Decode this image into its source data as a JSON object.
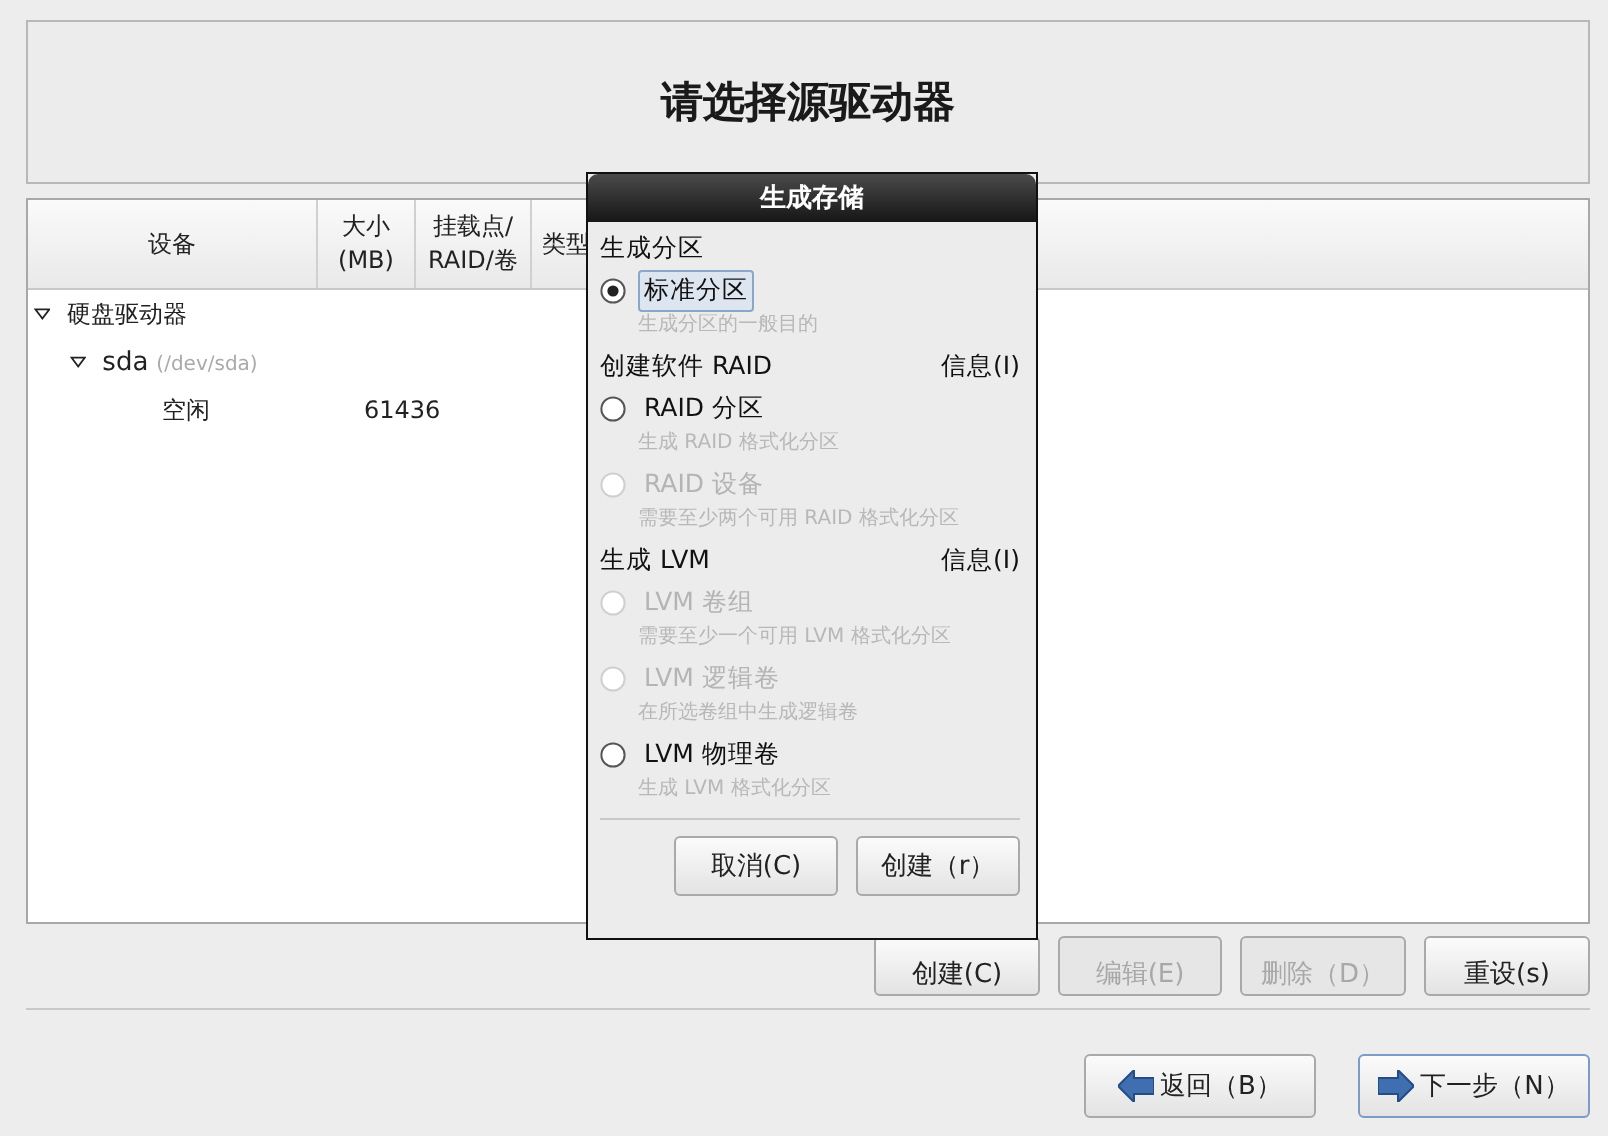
{
  "header": {
    "title": "请选择源驱动器"
  },
  "table": {
    "columns": [
      "设备",
      "大小\n(MB)",
      "挂载点/\nRAID/卷",
      "类型"
    ],
    "rows": [
      {
        "device": "硬盘驱动器",
        "expanded": true,
        "children": [
          {
            "device": "sda",
            "path": "(/dev/sda)",
            "expanded": true,
            "children": [
              {
                "device": "空闲",
                "size": "61436"
              }
            ]
          }
        ]
      }
    ]
  },
  "actions": [
    {
      "label": "创建(C)",
      "disabled": false
    },
    {
      "label": "编辑(E)",
      "disabled": true
    },
    {
      "label": "删除（D）",
      "disabled": true
    },
    {
      "label": "重设(s)",
      "disabled": false
    }
  ],
  "nav": [
    {
      "label": "返回（B）",
      "kind": "back",
      "focused": false
    },
    {
      "label": "下一步（N）",
      "kind": "next",
      "focused": true
    }
  ],
  "dialog": {
    "title": "生成存储",
    "sections": [
      {
        "heading": "生成分区",
        "options": [
          {
            "label": "标准分区",
            "description": "生成分区的一般目的",
            "selected": true,
            "disabled": false
          }
        ]
      },
      {
        "heading": "创建软件 RAID",
        "info": "信息(I)",
        "options": [
          {
            "label": "RAID 分区",
            "description": "生成 RAID 格式化分区",
            "selected": false,
            "disabled": false
          },
          {
            "label": "RAID 设备",
            "description": "需要至少两个可用 RAID 格式化分区",
            "selected": false,
            "disabled": true
          }
        ]
      },
      {
        "heading": "生成 LVM",
        "info": "信息(I)",
        "options": [
          {
            "label": "LVM 卷组",
            "description": "需要至少一个可用 LVM 格式化分区",
            "selected": false,
            "disabled": true
          },
          {
            "label": "LVM 逻辑卷",
            "description": "在所选卷组中生成逻辑卷",
            "selected": false,
            "disabled": true
          },
          {
            "label": "LVM 物理卷",
            "description": "生成 LVM 格式化分区",
            "selected": false,
            "disabled": false
          }
        ]
      }
    ],
    "buttons": [
      "取消(C)",
      "创建（r）"
    ]
  }
}
